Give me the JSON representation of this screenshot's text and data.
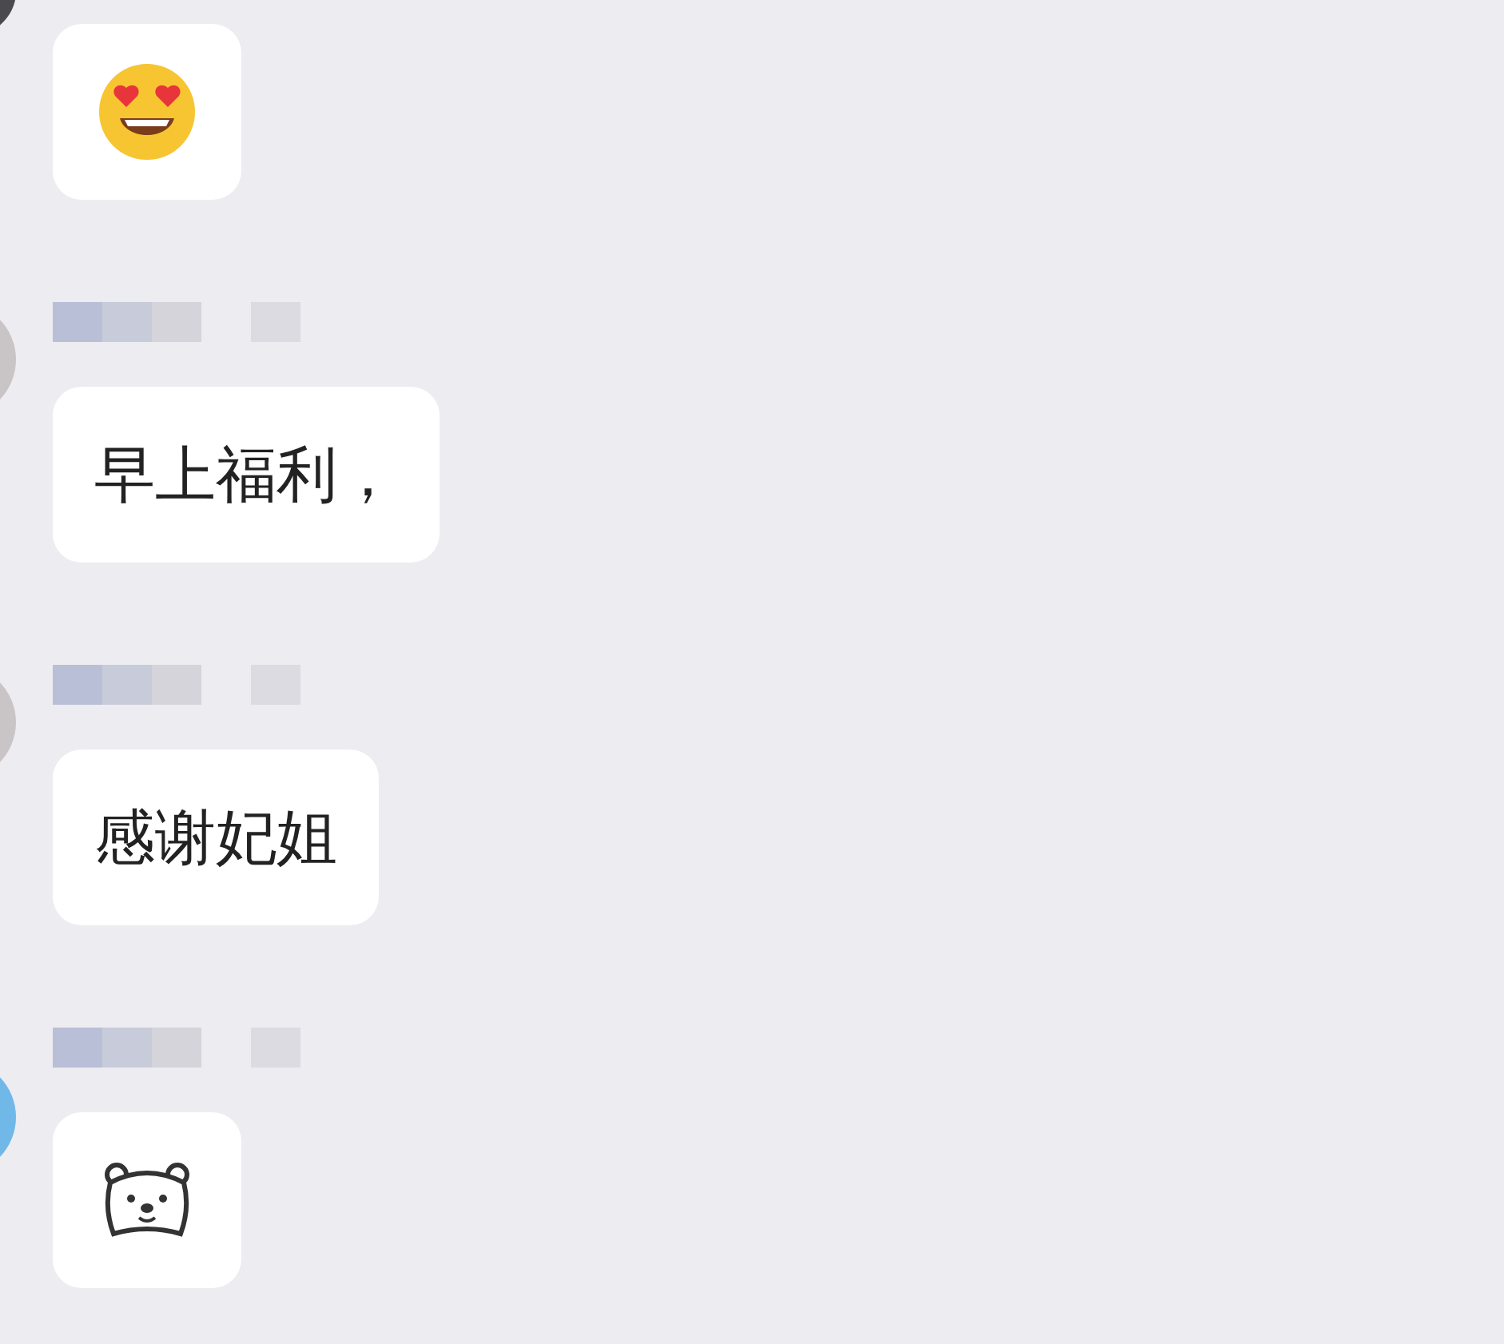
{
  "messages": [
    {
      "kind": "emoji",
      "name_shown": false,
      "avatar": {
        "color": "#4a4a4e"
      }
    },
    {
      "kind": "text",
      "name_shown": true,
      "avatar": {
        "color": "#c9c4c6"
      },
      "text": "早上福利，"
    },
    {
      "kind": "text",
      "name_shown": true,
      "avatar": {
        "color": "#c9c4c6"
      },
      "text": "感谢妃姐"
    },
    {
      "kind": "sticker",
      "name_shown": true,
      "avatar": {
        "color": "#6fb8e8"
      }
    }
  ]
}
